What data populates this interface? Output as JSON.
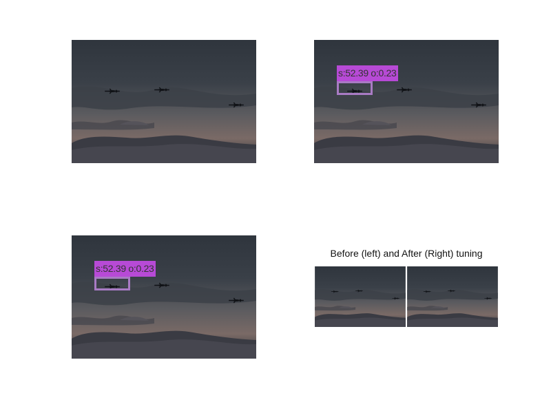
{
  "panels": [
    {
      "id": "original",
      "detection": null
    },
    {
      "id": "detection-1",
      "detection": {
        "label": "s:52.39 o:0.23"
      }
    },
    {
      "id": "detection-2",
      "detection": {
        "label": "s:52.39 o:0.23"
      }
    }
  ],
  "comparison": {
    "title": "Before (left) and After (Right) tuning"
  },
  "colors": {
    "label_bg": "#b74ad6",
    "box_border": "#a97bc4"
  }
}
